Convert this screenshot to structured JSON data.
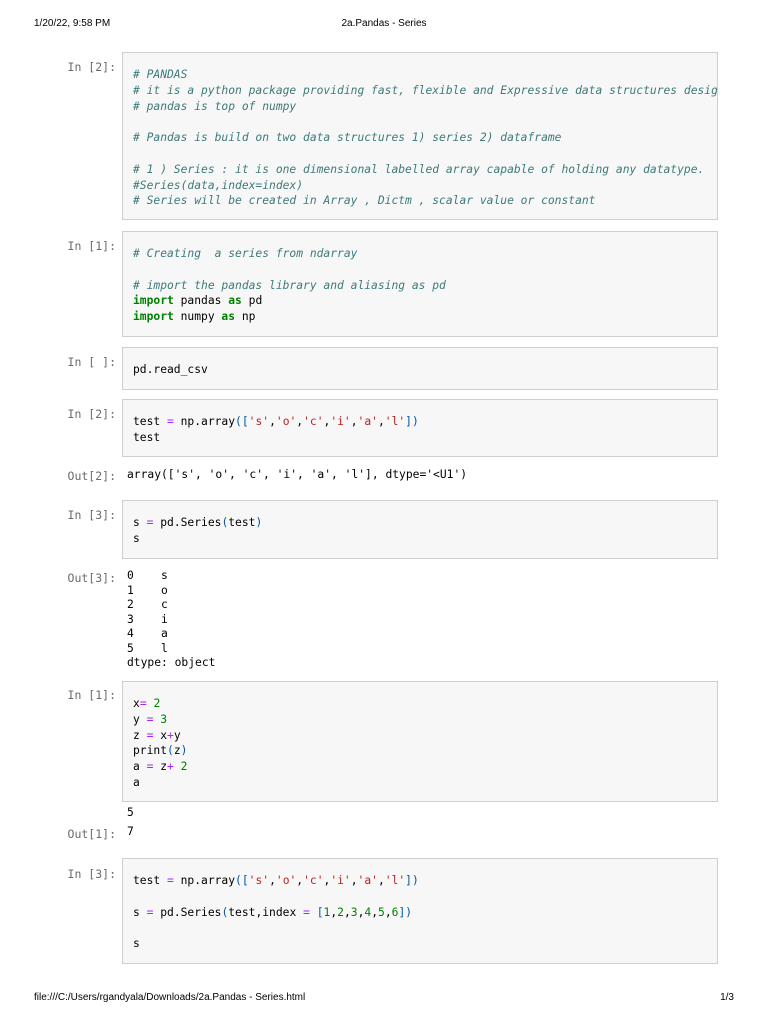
{
  "header": {
    "datetime": "1/20/22, 9:58 PM",
    "title": "2a.Pandas - Series"
  },
  "footer": {
    "path": "file:///C:/Users/rgandyala/Downloads/2a.Pandas - Series.html",
    "page": "1/3"
  },
  "cells": [
    {
      "prompt": "In [2]:",
      "lines": [
        "# PANDAS",
        "# it is a python package providing fast, flexible and Expressive data structures design",
        "# pandas is top of numpy",
        "",
        "# Pandas is build on two data structures 1) series 2) dataframe",
        "",
        "# 1 ) Series : it is one dimensional labelled array capable of holding any datatype.",
        "#Series(data,index=index)",
        "# Series will be created in Array , Dictm , scalar value or constant"
      ]
    },
    {
      "prompt": "In [1]:",
      "lines": [
        "# Creating  a series from ndarray",
        "",
        "# import the pandas library and aliasing as pd",
        "import pandas as pd",
        "import numpy as np"
      ]
    },
    {
      "prompt": "In [ ]:",
      "lines": [
        "pd.read_csv"
      ]
    },
    {
      "prompt": "In [2]:",
      "lines": [
        "test = np.array(['s','o','c','i','a','l'])",
        "test"
      ],
      "out_prompt": "Out[2]:",
      "output": "array(['s', 'o', 'c', 'i', 'a', 'l'], dtype='<U1')"
    },
    {
      "prompt": "In [3]:",
      "lines": [
        "s = pd.Series(test)",
        "s"
      ],
      "out_prompt": "Out[3]:",
      "output": "0    s\n1    o\n2    c\n3    i\n4    a\n5    l\ndtype: object"
    },
    {
      "prompt": "In [1]:",
      "lines": [
        "x= 2",
        "y = 3",
        "z = x+y",
        "print(z)",
        "a = z+ 2",
        "a"
      ],
      "stdout": "5",
      "out_prompt": "Out[1]:",
      "output": "7"
    },
    {
      "prompt": "In [3]:",
      "lines": [
        "test = np.array(['s','o','c','i','a','l'])",
        "",
        "s = pd.Series(test,index = [1,2,3,4,5,6])",
        "",
        "s"
      ]
    }
  ]
}
